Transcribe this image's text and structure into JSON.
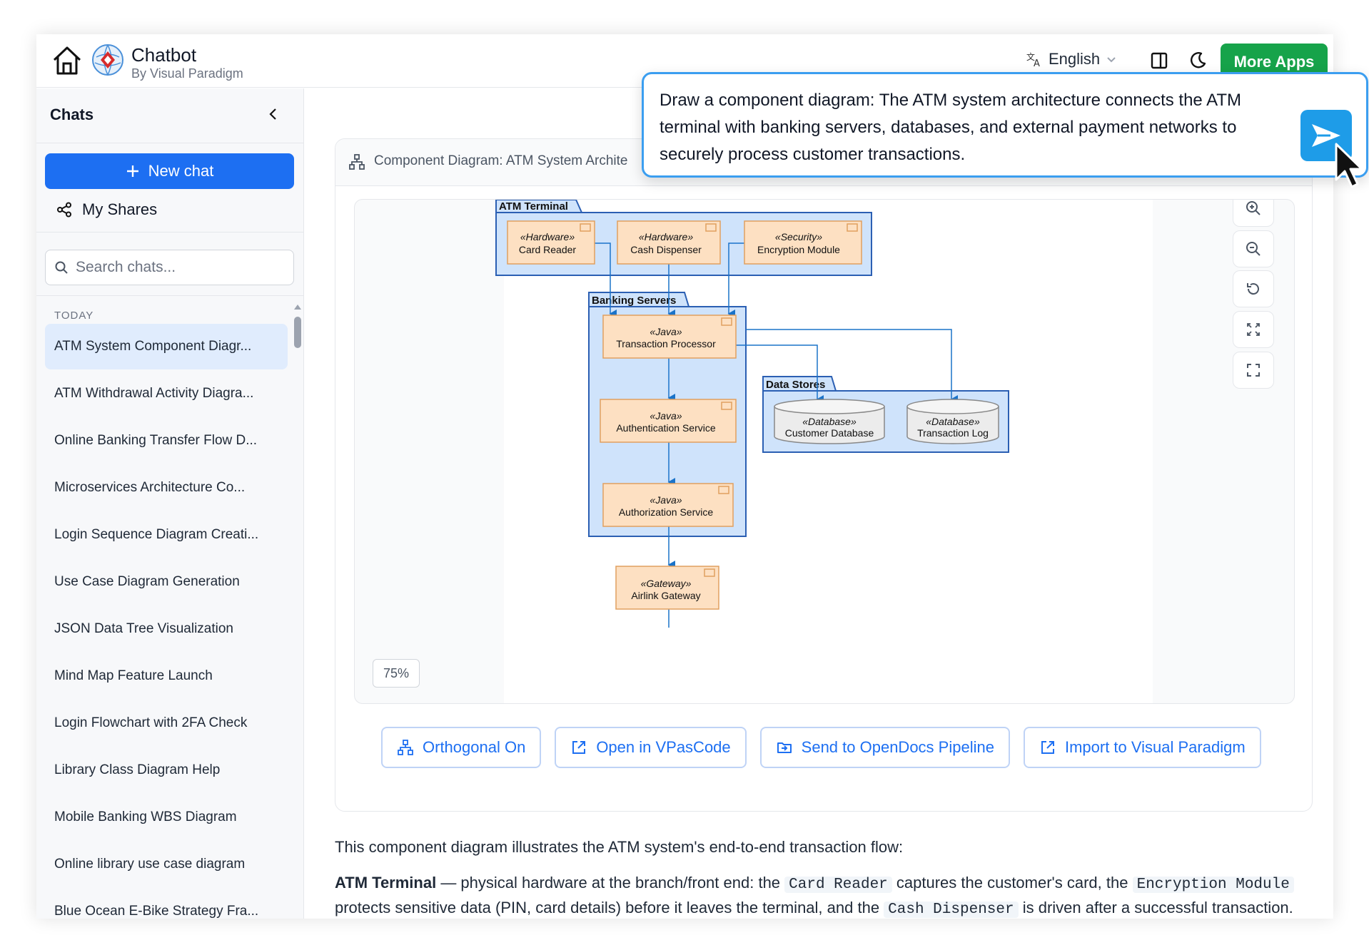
{
  "header": {
    "brand_title": "Chatbot",
    "brand_subtitle": "By Visual Paradigm",
    "language": "English",
    "more_apps": "More Apps"
  },
  "sidebar": {
    "title": "Chats",
    "new_chat": "New chat",
    "my_shares": "My Shares",
    "search_placeholder": "Search chats...",
    "section_today": "TODAY",
    "chats": [
      "ATM System Component Diagr...",
      "ATM Withdrawal Activity Diagra...",
      "Online Banking Transfer Flow D...",
      "Microservices Architecture Co...",
      "Login Sequence Diagram Creati...",
      "Use Case Diagram Generation",
      "JSON Data Tree Visualization",
      "Mind Map Feature Launch",
      "Login Flowchart with 2FA Check",
      "Library Class Diagram Help",
      "Mobile Banking WBS Diagram",
      "Online library use case diagram",
      "Blue Ocean E-Bike Strategy Fra..."
    ]
  },
  "card": {
    "title": "Component Diagram: ATM System Archite",
    "zoom_level": "75%"
  },
  "diagram": {
    "packages": {
      "atm": "ATM Terminal",
      "banking": "Banking Servers",
      "data": "Data Stores"
    },
    "components": {
      "card_reader": {
        "stereotype": "«Hardware»",
        "name": "Card Reader"
      },
      "cash_dispenser": {
        "stereotype": "«Hardware»",
        "name": "Cash Dispenser"
      },
      "encryption": {
        "stereotype": "«Security»",
        "name": "Encryption Module"
      },
      "transaction": {
        "stereotype": "«Java»",
        "name": "Transaction Processor"
      },
      "authentication": {
        "stereotype": "«Java»",
        "name": "Authentication Service"
      },
      "authorization": {
        "stereotype": "«Java»",
        "name": "Authorization Service"
      },
      "gateway": {
        "stereotype": "«Gateway»",
        "name": "Airlink Gateway"
      },
      "customer_db": {
        "stereotype": "«Database»",
        "name": "Customer Database"
      },
      "transaction_log": {
        "stereotype": "«Database»",
        "name": "Transaction Log"
      }
    }
  },
  "actions": {
    "orthogonal": "Orthogonal On",
    "open_vpascode": "Open in VPasCode",
    "send_opendocs": "Send to OpenDocs Pipeline",
    "import_vp": "Import to Visual Paradigm"
  },
  "description": {
    "intro": "This component diagram illustrates the ATM system's end-to-end transaction flow:",
    "atm_label": "ATM Terminal",
    "atm_text_1": " — physical hardware at the branch/front end: the ",
    "code_card_reader": "Card Reader",
    "atm_text_2": " captures the customer's card, the ",
    "code_encryption": "Encryption Module",
    "atm_text_3": " protects sensitive data (PIN, card details) before it leaves the terminal, and the ",
    "code_cash": "Cash Dispenser",
    "atm_text_4": " is driven after a successful transaction."
  },
  "prompt": {
    "text": "Draw a component diagram: The ATM system architecture connects the ATM terminal with banking servers, databases, and external payment networks to securely process customer transactions."
  },
  "colors": {
    "accent": "#1d6ff2",
    "green": "#16a34a",
    "package_fill": "#cfe3fb",
    "package_stroke": "#2b5fb3",
    "component_fill": "#fde0c2",
    "component_stroke": "#e0a060"
  }
}
